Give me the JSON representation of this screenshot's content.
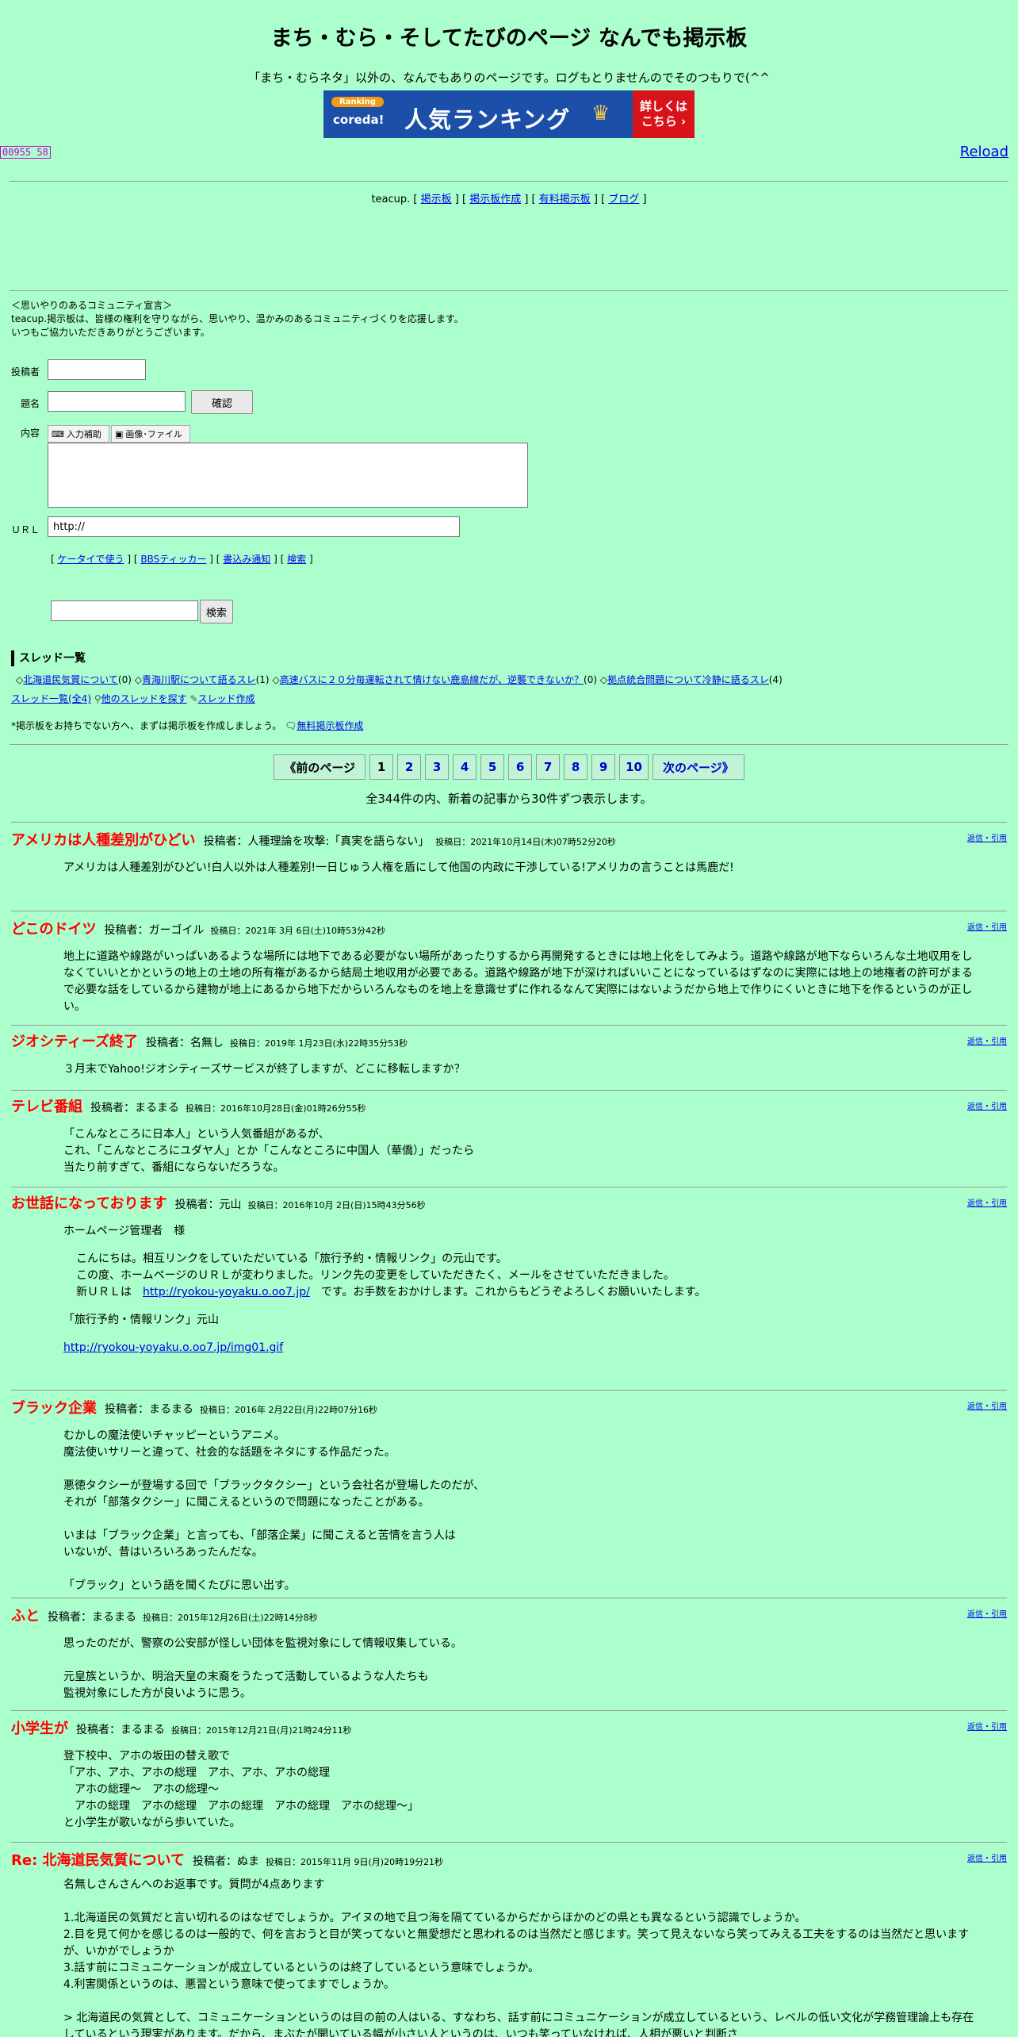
{
  "header": {
    "title": "まち・むら・そしてたびのページ なんでも掲示板",
    "subtitle": "「まち・むらネタ」以外の、なんでもありのページです。ログもとりませんのでそのつもりで(^^",
    "banner_ranking": "Ranking",
    "banner_coreda": "coreda!",
    "banner_main": "人気ランキング",
    "banner_right": "詳しくは\nこちら ›"
  },
  "counter": "00955 58",
  "reload": "Reload",
  "teacup": {
    "prefix": "teacup.",
    "links": [
      "掲示板",
      "掲示板作成",
      "有料掲示板",
      "ブログ"
    ]
  },
  "declaration": {
    "line1": "＜思いやりのあるコミュニティ宣言＞",
    "line2": "teacup.掲示板は、皆様の権利を守りながら、思いやり、温かみのあるコミュニティづくりを応援します。",
    "line3": "いつもご協力いただきありがとうございます。"
  },
  "form": {
    "author_label": "投稿者",
    "subject_label": "題名",
    "confirm_button": "確認",
    "content_label": "内容",
    "input_assist": "入力補助",
    "image_file": "画像･ファイル",
    "url_label": "ＵＲＬ",
    "url_value": "http://",
    "links": [
      "ケータイで使う",
      "BBSティッカー",
      "書込み通知",
      "検索"
    ],
    "search_button": "検索"
  },
  "threads": {
    "heading": "スレッド一覧",
    "items": [
      {
        "title": "北海道民気質について",
        "count": "(0)"
      },
      {
        "title": "青海川駅について語るスレ",
        "count": "(1)"
      },
      {
        "title": "高速バスに２０分毎運転されて情けない鹿島線だが、逆襲できないか？",
        "count": "(0)"
      },
      {
        "title": "拠点統合問題について冷静に語るスレ",
        "count": "(4)"
      }
    ],
    "all_link": "スレッド一覧(全4)",
    "find_link": "他のスレッドを探す",
    "create_link": "スレッド作成",
    "note": "*掲示板をお持ちでない方へ、まずは掲示板を作成しましょう。",
    "free_create": "無料掲示板作成"
  },
  "pager": {
    "prev": "《前のページ",
    "pages": [
      "1",
      "2",
      "3",
      "4",
      "5",
      "6",
      "7",
      "8",
      "9",
      "10"
    ],
    "next": "次のページ》",
    "total": "全344件の内、新着の記事から30件ずつ表示します。"
  },
  "posts": [
    {
      "title": "アメリカは人種差別がひどい",
      "author": "投稿者：人種理論を攻撃:「真実を語らない」",
      "date": "投稿日：2021年10月14日(木)07時52分20秒",
      "reply": "返信・引用",
      "body": "アメリカは人種差別がひどい!白人以外は人種差別!一日じゅう人権を盾にして他国の内政に干渉している!アメリカの言うことは馬鹿だ!"
    },
    {
      "title": "どこのドイツ",
      "author": "投稿者：ガーゴイル",
      "date": "投稿日：2021年 3月 6日(土)10時53分42秒",
      "reply": "返信・引用",
      "body": "地上に道路や線路がいっぱいあるような場所には地下である必要がない場所があったりするから再開発するときには地上化をしてみよう。道路や線路が地下ならいろんな土地収用をしなくていいとかというの地上の土地の所有権があるから結局土地収用が必要である。道路や線路が地下が深ければいいことになっているはずなのに実際には地上の地権者の許可がまるで必要な話をしているから建物が地上にあるから地下だからいろんなものを地上を意識せずに作れるなんて実際にはないようだから地上で作りにくいときに地下を作るというのが正しい。"
    },
    {
      "title": "ジオシティーズ終了",
      "author": "投稿者：名無し",
      "date": "投稿日：2019年 1月23日(水)22時35分53秒",
      "reply": "返信・引用",
      "body": "３月末でYahoo!ジオシティーズサービスが終了しますが、どこに移転しますか？"
    },
    {
      "title": "テレビ番組",
      "author": "投稿者：まるまる",
      "date": "投稿日：2016年10月28日(金)01時26分55秒",
      "reply": "返信・引用",
      "body": "「こんなところに日本人」という人気番組があるが、\nこれ、「こんなところにユダヤ人」とか「こんなところに中国人（華僑）」だったら\n当たり前すぎて、番組にならないだろうな。"
    },
    {
      "title": "お世話になっております",
      "author": "投稿者：元山",
      "date": "投稿日：2016年10月 2日(日)15時43分56秒",
      "reply": "返信・引用",
      "body_intro": "ホームページ管理者　様",
      "body_l1": "こんにちは。相互リンクをしていただいている「旅行予約・情報リンク」の元山です。",
      "body_l2": "この度、ホームページのＵＲＬが変わりました。リンク先の変更をしていただきたく、メールをさせていただきました。",
      "body_l3a": "新ＵＲＬは　",
      "body_link": "http://ryokou-yoyaku.o.oo7.jp/",
      "body_l3b": "　です。お手数をおかけします。これからもどうぞよろしくお願いいたします。",
      "body_sign": "「旅行予約・情報リンク」元山",
      "body_img": "http://ryokou-yoyaku.o.oo7.jp/img01.gif"
    },
    {
      "title": "ブラック企業",
      "author": "投稿者：まるまる",
      "date": "投稿日：2016年 2月22日(月)22時07分16秒",
      "reply": "返信・引用",
      "body": "むかしの魔法使いチャッピーというアニメ。\n魔法使いサリーと違って、社会的な話題をネタにする作品だった。\n\n悪徳タクシーが登場する回で「ブラックタクシー」という会社名が登場したのだが、\nそれが「部落タクシー」に聞こえるというので問題になったことがある。\n\nいまは「ブラック企業」と言っても、「部落企業」に聞こえると苦情を言う人は\nいないが、昔はいろいろあったんだな。\n\n「ブラック」という語を聞くたびに思い出す。"
    },
    {
      "title": "ふと",
      "author": "投稿者：まるまる",
      "date": "投稿日：2015年12月26日(土)22時14分8秒",
      "reply": "返信・引用",
      "body": "思ったのだが、警察の公安部が怪しい団体を監視対象にして情報収集している。\n\n元皇族というか、明治天皇の末裔をうたって活動しているような人たちも\n監視対象にした方が良いように思う。"
    },
    {
      "title": "小学生が",
      "author": "投稿者：まるまる",
      "date": "投稿日：2015年12月21日(月)21時24分11秒",
      "reply": "返信・引用",
      "body": "登下校中、アホの坂田の替え歌で\n「アホ、アホ、アホの総理　アホ、アホ、アホの総理\n　アホの総理～　アホの総理～\n　アホの総理　アホの総理　アホの総理　アホの総理　アホの総理～」\nと小学生が歌いながら歩いていた。"
    },
    {
      "title": "Re: 北海道民気質について",
      "author": "投稿者：ぬま",
      "date": "投稿日：2015年11月 9日(月)20時19分21秒",
      "reply": "返信・引用",
      "body": "名無しさんさんへのお返事です。質問が4点あります\n\n1.北海道民の気質だと言い切れるのはなぜでしょうか。アイヌの地で且つ海を隔てているからだからほかのどの県とも異なるという認識でしょうか。\n2.目を見て何かを感じるのは一般的で、何を言おうと目が笑ってないと無愛想だと思われるのは当然だと感じます。笑って見えないなら笑ってみえる工夫をするのは当然だと思いますが、いかがでしょうか\n3.話す前にコミュニケーションが成立しているというのは終了しているという意味でしょうか。\n4.利害関係というのは、悪習という意味で使ってますでしょうか。\n\n> 北海道民の気質として、コミュニケーションというのは目の前の人はいる、すなわち、話す前にコミュニケーションが成立しているという、レベルの低い文化が学務管理論上も存在しているという現実があります。だから、まぶたが開いている幅が小さい人というのは、いつも笑っていなければ、人相が悪いと判断さ"
    }
  ]
}
